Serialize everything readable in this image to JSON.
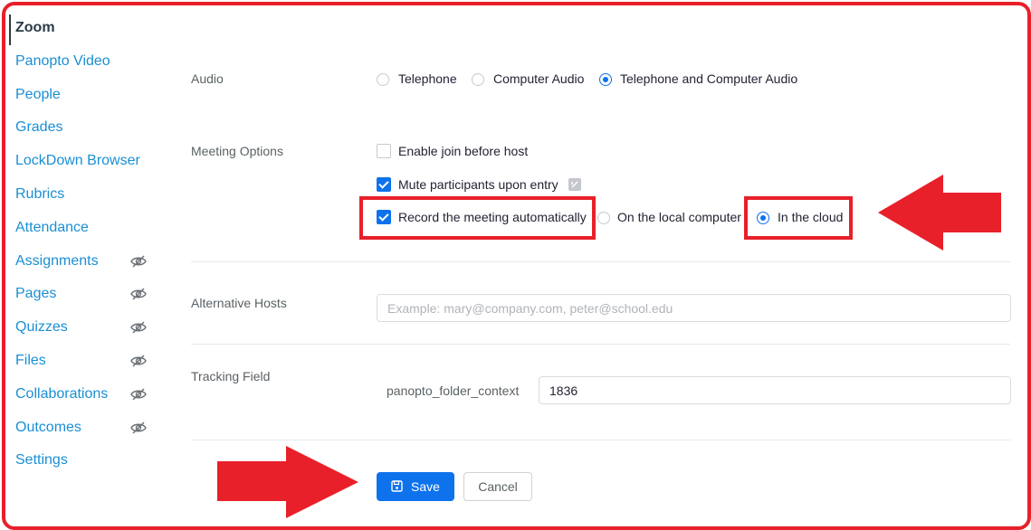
{
  "sidebar": {
    "items": [
      {
        "label": "Zoom",
        "active": true,
        "hidden": false
      },
      {
        "label": "Panopto Video",
        "active": false,
        "hidden": false
      },
      {
        "label": "People",
        "active": false,
        "hidden": false
      },
      {
        "label": "Grades",
        "active": false,
        "hidden": false
      },
      {
        "label": "LockDown Browser",
        "active": false,
        "hidden": false
      },
      {
        "label": "Rubrics",
        "active": false,
        "hidden": false
      },
      {
        "label": "Attendance",
        "active": false,
        "hidden": false
      },
      {
        "label": "Assignments",
        "active": false,
        "hidden": true
      },
      {
        "label": "Pages",
        "active": false,
        "hidden": true
      },
      {
        "label": "Quizzes",
        "active": false,
        "hidden": true
      },
      {
        "label": "Files",
        "active": false,
        "hidden": true
      },
      {
        "label": "Collaborations",
        "active": false,
        "hidden": true
      },
      {
        "label": "Outcomes",
        "active": false,
        "hidden": true
      },
      {
        "label": "Settings",
        "active": false,
        "hidden": false
      }
    ]
  },
  "audio": {
    "label": "Audio",
    "options": [
      "Telephone",
      "Computer Audio",
      "Telephone and Computer Audio"
    ],
    "selected": "Telephone and Computer Audio"
  },
  "meeting_options": {
    "label": "Meeting Options",
    "enable_join_before_host": {
      "label": "Enable join before host",
      "checked": false
    },
    "mute_participants": {
      "label": "Mute participants upon entry",
      "checked": true
    },
    "record_automatically": {
      "label": "Record the meeting automatically",
      "checked": true
    },
    "record_location": {
      "options": [
        "On the local computer",
        "In the cloud"
      ],
      "selected": "In the cloud"
    }
  },
  "alternative_hosts": {
    "label": "Alternative Hosts",
    "placeholder": "Example: mary@company.com, peter@school.edu",
    "value": ""
  },
  "tracking_field": {
    "label": "Tracking Field",
    "field_name": "panopto_folder_context",
    "value": "1836"
  },
  "buttons": {
    "save": "Save",
    "cancel": "Cancel"
  },
  "colors": {
    "accent": "#0e72ed",
    "link": "#1a8fd4",
    "annotation_red": "#e8202a"
  }
}
